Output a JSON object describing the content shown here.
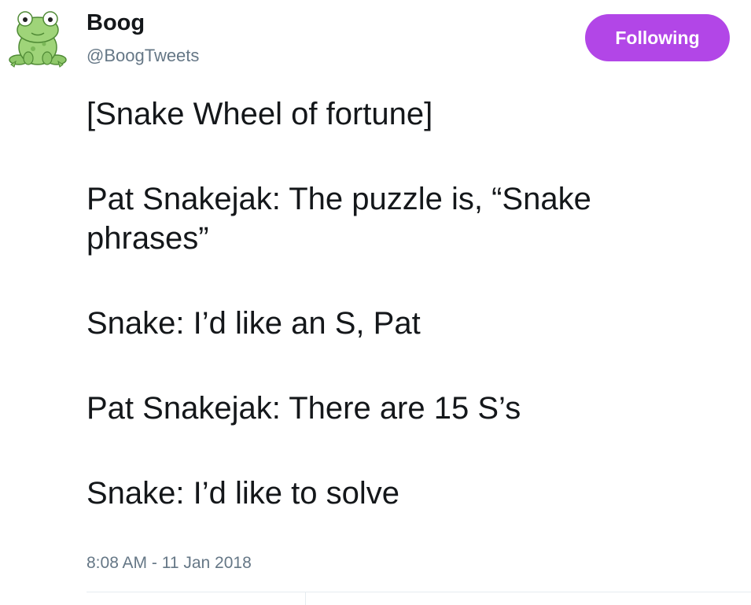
{
  "user": {
    "display_name": "Boog",
    "handle": "@BoogTweets",
    "avatar_icon": "frog-icon"
  },
  "follow_button": {
    "label": "Following",
    "color": "#b246e7"
  },
  "tweet": {
    "paragraphs": [
      "[Snake Wheel of fortune]",
      "Pat Snakejak: The puzzle is, “Snake phrases”",
      "Snake: I’d like an S, Pat",
      "Pat Snakejak: There are 15 S’s",
      "Snake: I’d like to solve"
    ],
    "timestamp": "8:08 AM - 11 Jan 2018"
  }
}
